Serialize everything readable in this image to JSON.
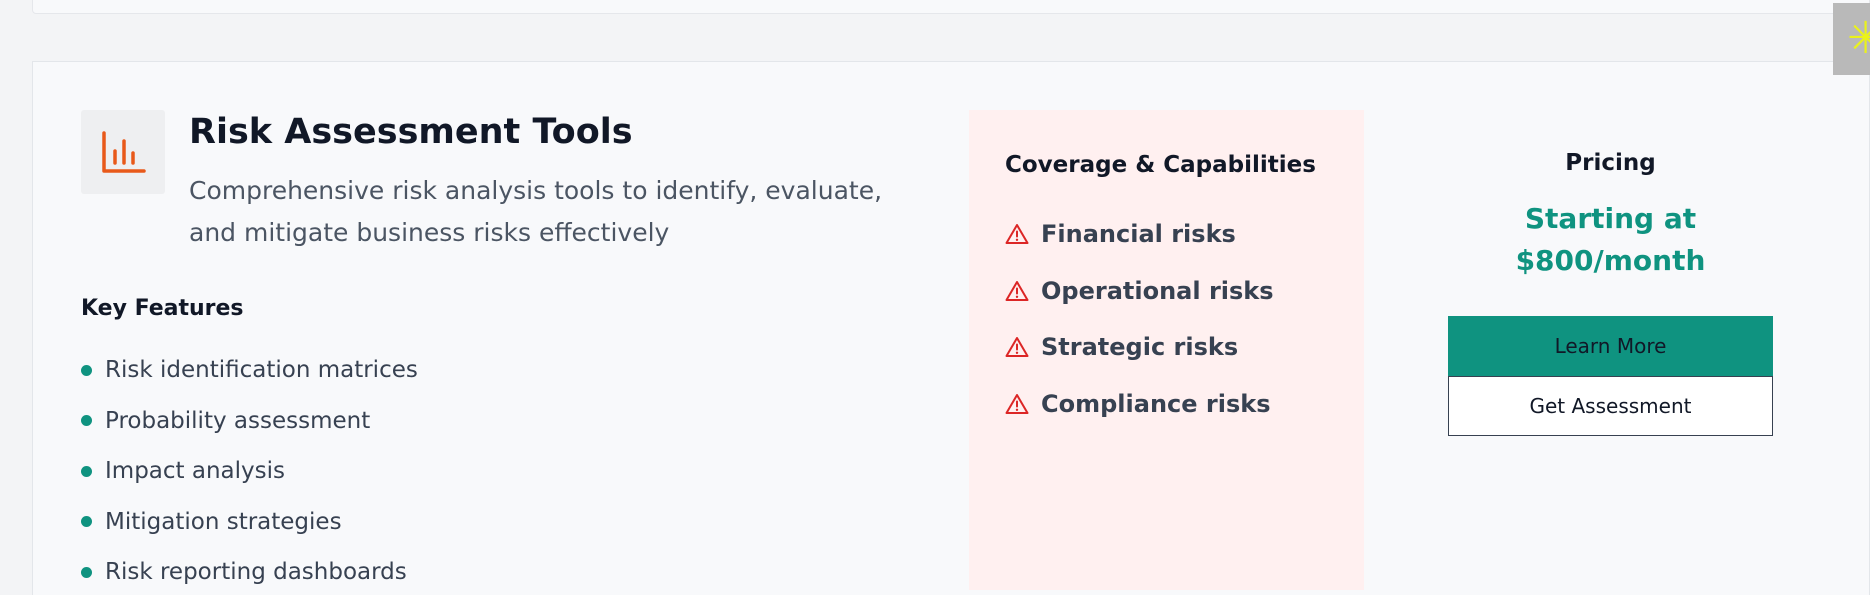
{
  "service": {
    "title": "Risk Assessment Tools",
    "description": "Comprehensive risk analysis tools to identify, evaluate, and mitigate business risks effectively",
    "icon": "bar-chart-icon",
    "accent_color": "#e8591a"
  },
  "key_features": {
    "heading": "Key Features",
    "items": [
      "Risk identification matrices",
      "Probability assessment",
      "Impact analysis",
      "Mitigation strategies",
      "Risk reporting dashboards"
    ]
  },
  "coverage": {
    "heading": "Coverage & Capabilities",
    "icon": "warning-icon",
    "icon_color": "#dc2626",
    "items": [
      "Financial risks",
      "Operational risks",
      "Strategic risks",
      "Compliance risks"
    ]
  },
  "pricing": {
    "label": "Pricing",
    "price": "Starting at $800/month",
    "learn_more": "Learn More",
    "get_assessment": "Get Assessment",
    "color": "#0f9380"
  }
}
